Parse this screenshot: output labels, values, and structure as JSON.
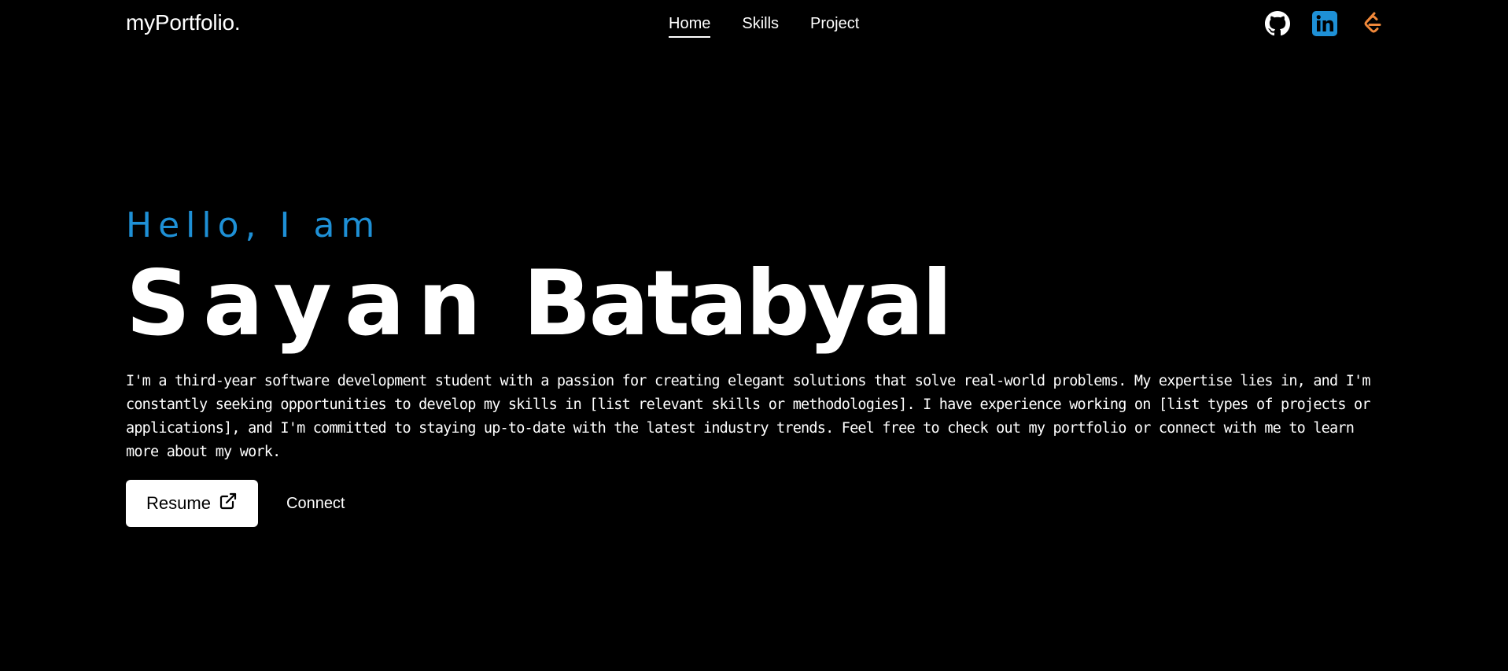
{
  "navbar": {
    "brand": "myPortfolio.",
    "links": [
      {
        "label": "Home",
        "active": true
      },
      {
        "label": "Skills",
        "active": false
      },
      {
        "label": "Project",
        "active": false
      }
    ],
    "socials": [
      {
        "icon": "github-icon",
        "color": "#ffffff"
      },
      {
        "icon": "linkedin-icon",
        "color": "#1e90d6"
      },
      {
        "icon": "leetcode-icon",
        "color": "#f0883a"
      }
    ]
  },
  "hero": {
    "greeting": "Hello, I am",
    "first_name": "Sayan",
    "last_name": "Batabyal",
    "bio": "I'm a third-year software development student with a passion for creating elegant solutions that solve real-world problems. My expertise lies in, and I'm constantly seeking opportunities to develop my skills in [list relevant skills or methodologies]. I have experience working on [list types of projects or applications], and I'm committed to staying up-to-date with the latest industry trends. Feel free to check out my portfolio or connect with me to learn more about my work.",
    "resume_label": "Resume",
    "connect_label": "Connect"
  },
  "colors": {
    "background": "#000000",
    "accent": "#1e90d6",
    "text": "#ffffff"
  }
}
